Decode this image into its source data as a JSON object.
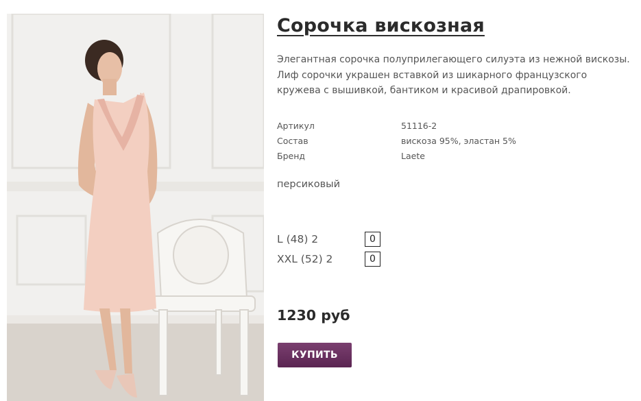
{
  "product": {
    "title": "Сорочка вискозная",
    "description": "Элегантная сорочка полуприлегающего силуэта из нежной вискозы. Лиф сорочки украшен вставкой из шикарного французского кружева с вышивкой, бантиком и красивой драпировкой.",
    "specs": [
      {
        "label": "Артикул",
        "value": "51116-2"
      },
      {
        "label": "Состав",
        "value": "вискоза 95%, эластан 5%"
      },
      {
        "label": "Бренд",
        "value": "Laete"
      }
    ],
    "color": "персиковый",
    "sizes": [
      {
        "label": "L (48)  2",
        "quantity": "0"
      },
      {
        "label": "XXL (52)  2",
        "quantity": "0"
      }
    ],
    "price": "1230 руб",
    "buy_label": "КУПИТЬ"
  },
  "colors": {
    "accent": "#6a2f61",
    "text": "#555555",
    "heading": "#2b2b2b"
  }
}
